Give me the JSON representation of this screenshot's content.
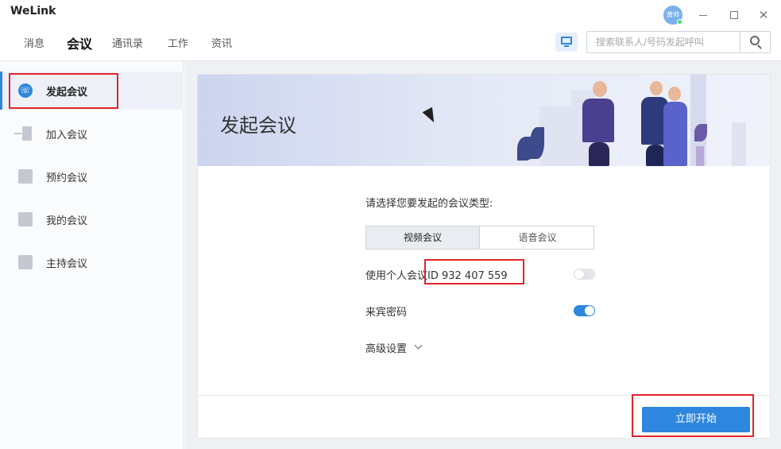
{
  "app": {
    "title": "WeLink",
    "avatar_text": "黄帅"
  },
  "nav": {
    "tabs": [
      {
        "label": "消息"
      },
      {
        "label": "会议"
      },
      {
        "label": "通讯录"
      },
      {
        "label": "工作"
      },
      {
        "label": "资讯"
      }
    ],
    "active_tab": "会议",
    "search_placeholder": "搜索联系人/号码发起呼叫"
  },
  "sidebar": {
    "items": [
      {
        "label": "发起会议",
        "icon": "phone-icon",
        "active": true
      },
      {
        "label": "加入会议",
        "icon": "join-icon"
      },
      {
        "label": "预约会议",
        "icon": "calendar-clock-icon"
      },
      {
        "label": "我的会议",
        "icon": "calendar-person-icon"
      },
      {
        "label": "主持会议",
        "icon": "host-icon"
      }
    ]
  },
  "main": {
    "banner_title": "发起会议",
    "prompt": "请选择您要发起的会议类型:",
    "types": [
      {
        "label": "视频会议",
        "active": true
      },
      {
        "label": "语音会议",
        "active": false
      }
    ],
    "personal_id_label": "使用个人会议ID 932 407 559",
    "personal_id_enabled": false,
    "guest_password_label": "来宾密码",
    "guest_password_enabled": true,
    "advanced_label": "高级设置",
    "start_button": "立即开始"
  },
  "colors": {
    "accent": "#2e86de",
    "highlight": "#e0242a"
  }
}
